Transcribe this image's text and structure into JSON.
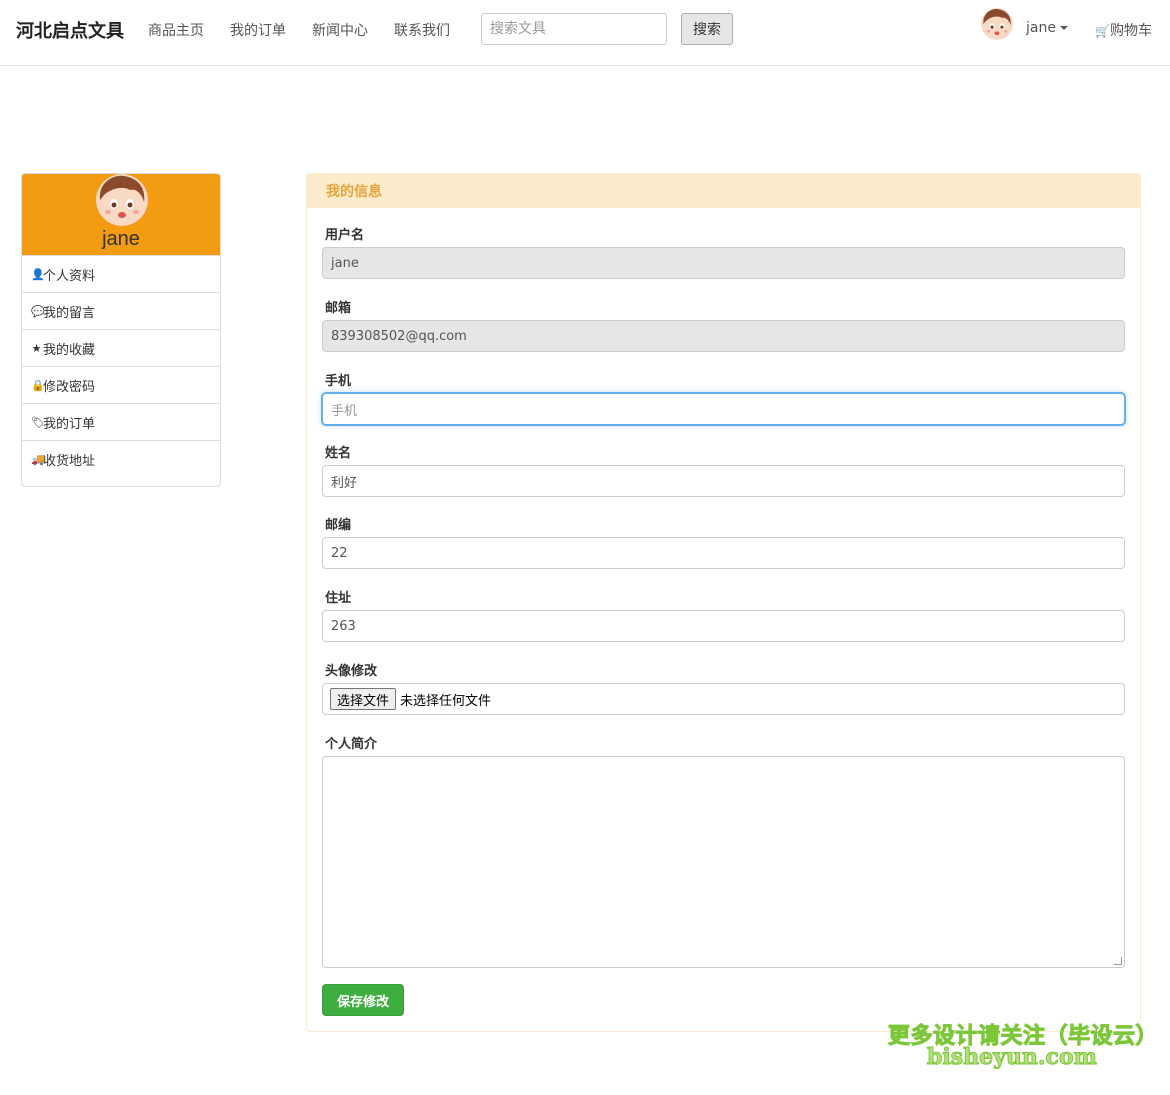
{
  "navbar": {
    "brand": "河北启点文具",
    "links": [
      "商品主页",
      "我的订单",
      "新闻中心",
      "联系我们"
    ],
    "search_placeholder": "搜索文具",
    "search_button": "搜索",
    "user": "jane",
    "cart": "购物车"
  },
  "sidebar": {
    "name": "jane",
    "items": [
      {
        "icon": "user-icon",
        "label": "个人资料"
      },
      {
        "icon": "comment-icon",
        "label": "我的留言"
      },
      {
        "icon": "star-icon",
        "label": "我的收藏"
      },
      {
        "icon": "lock-icon",
        "label": "修改密码"
      },
      {
        "icon": "tags-icon",
        "label": "我的订单"
      },
      {
        "icon": "truck-icon",
        "label": "收货地址"
      }
    ]
  },
  "panel": {
    "title": "我的信息",
    "fields": {
      "username": {
        "label": "用户名",
        "value": "jane"
      },
      "email": {
        "label": "邮箱",
        "value": "839308502@qq.com"
      },
      "phone": {
        "label": "手机",
        "placeholder": "手机"
      },
      "name": {
        "label": "姓名",
        "value": "利好"
      },
      "zip": {
        "label": "邮编",
        "value": "22"
      },
      "address": {
        "label": "住址",
        "value": "263"
      },
      "avatar": {
        "label": "头像修改",
        "button": "选择文件",
        "status": "未选择任何文件"
      },
      "bio": {
        "label": "个人简介",
        "value": ""
      }
    },
    "save_button": "保存修改"
  },
  "watermark": {
    "line1": "更多设计请关注（毕设云）",
    "line2": "bisheyun.com"
  },
  "colors": {
    "accent": "#f39c12",
    "panel_header_text": "#e8a33d",
    "save_button": "#3fae41"
  }
}
